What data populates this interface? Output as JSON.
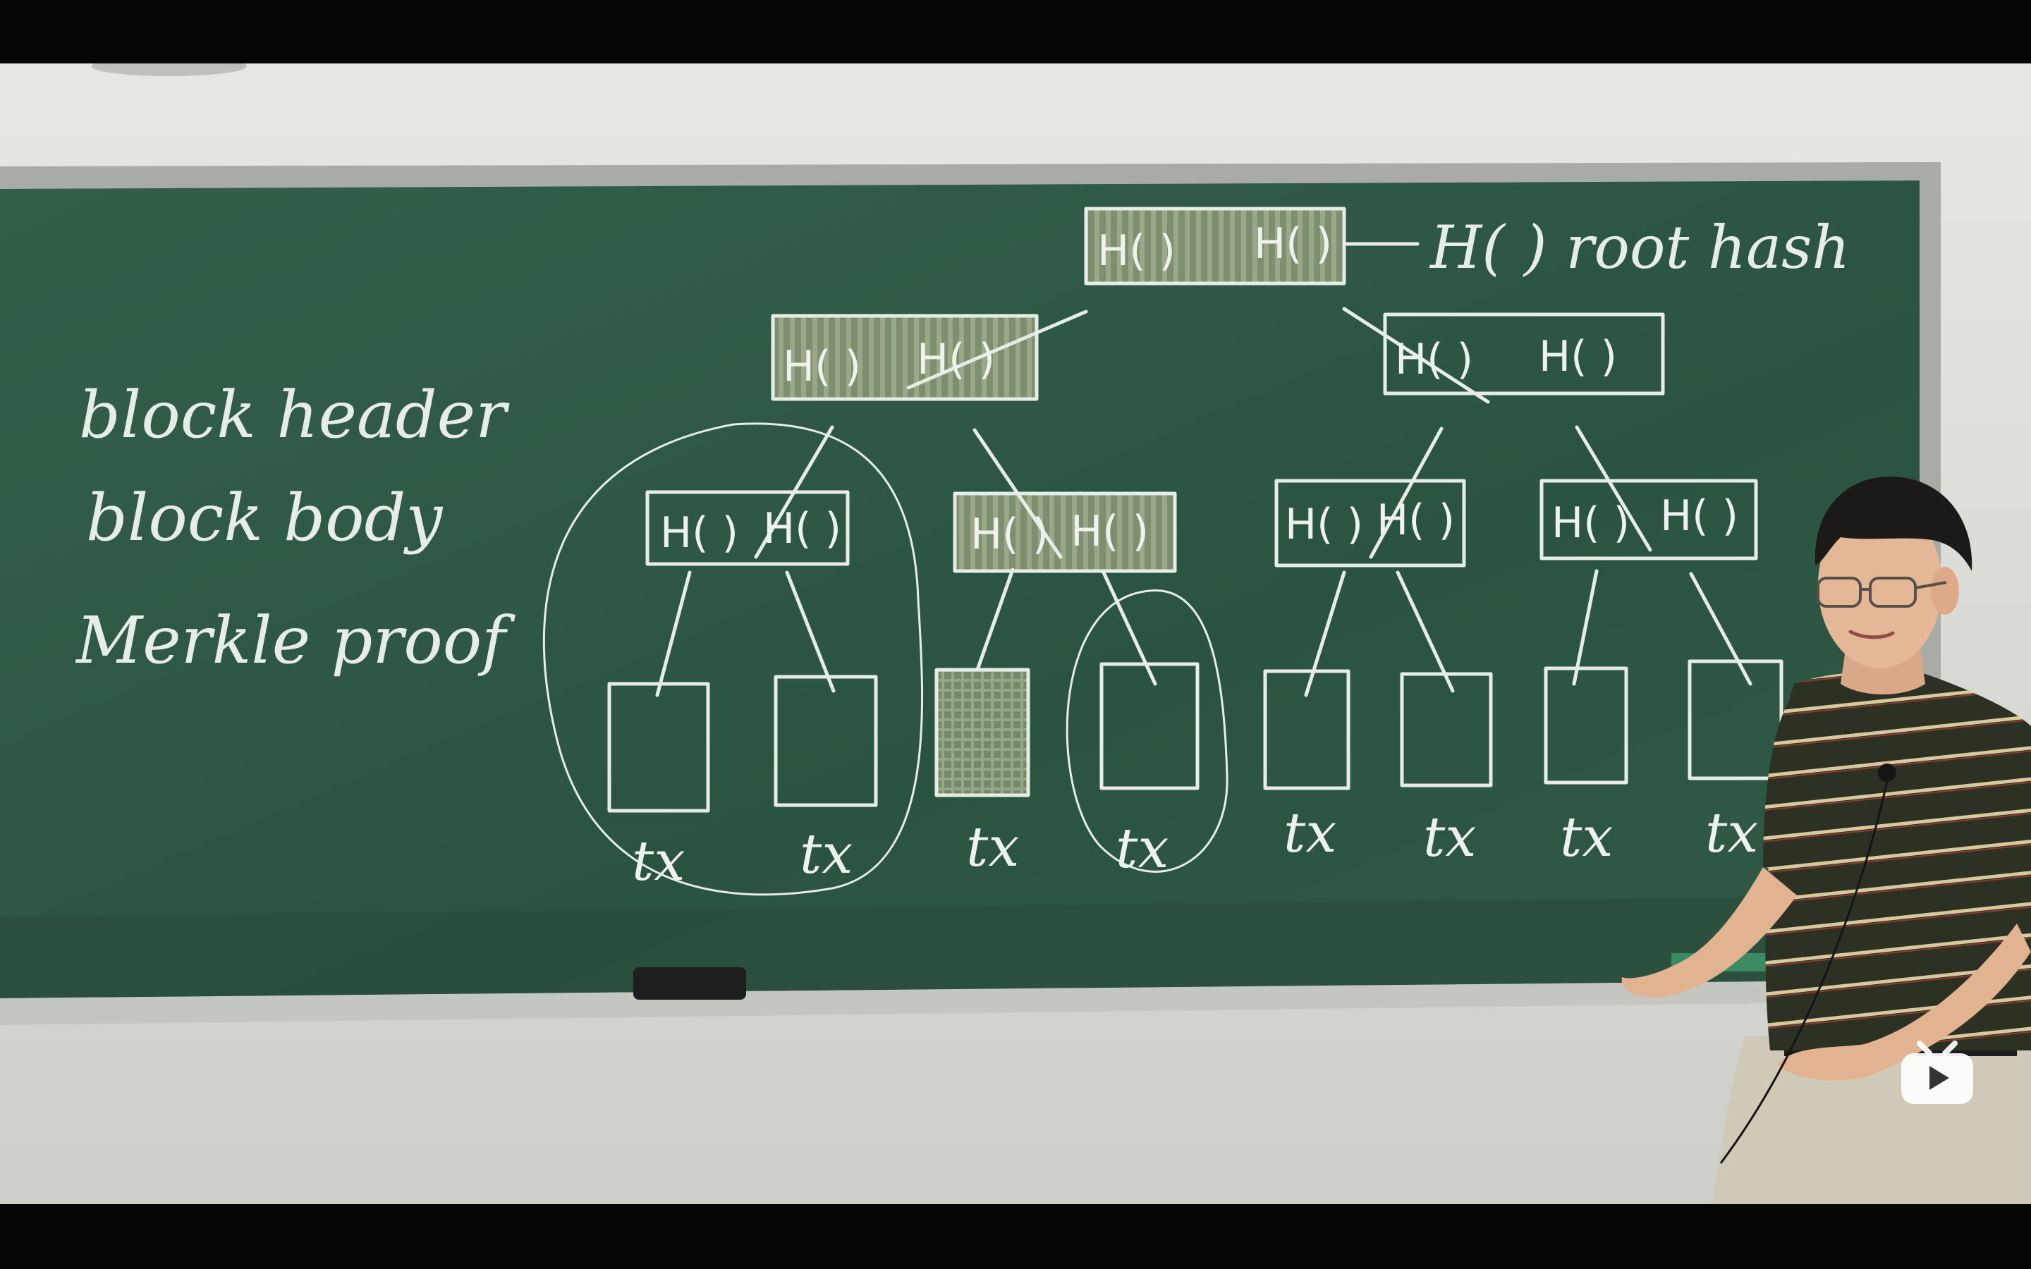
{
  "board": {
    "left_notes": [
      "block header",
      "block body",
      "Merkle proof"
    ],
    "root_label": "H( ) root hash",
    "hash_pair_left": "H( )",
    "hash_pair_right": "H( )",
    "leaf_label": "tx"
  },
  "colors": {
    "chalkboard": "#2f5a45",
    "chalk": "#e6ece6",
    "wall": "#dcdcd8",
    "frame": "#a7a9a3",
    "shirt": "#2f3324"
  },
  "player": {
    "logo_icon": "play-tv-icon"
  }
}
